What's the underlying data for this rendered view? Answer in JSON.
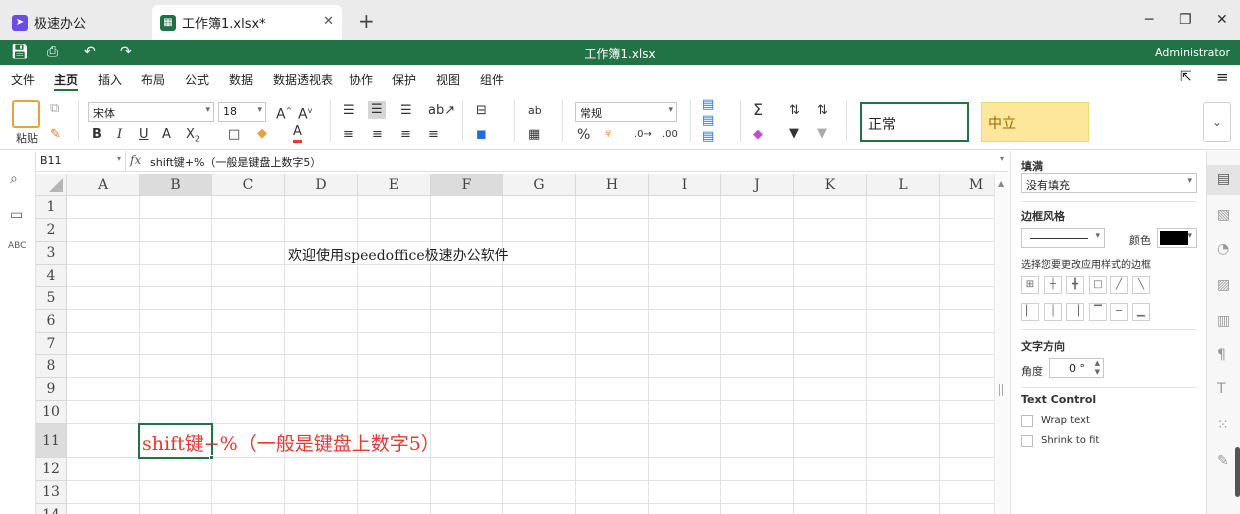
{
  "tabs": [
    {
      "label": "极速办公"
    },
    {
      "label": "工作簿1.xlsx*"
    }
  ],
  "window": {
    "title": "工作簿1.xlsx",
    "user": "Administrator"
  },
  "menu": [
    "文件",
    "主页",
    "插入",
    "布局",
    "公式",
    "数据",
    "数据透视表",
    "协作",
    "保护",
    "视图",
    "组件"
  ],
  "ribbon": {
    "paste_label": "粘贴",
    "font_name": "宋体",
    "font_size": "18",
    "number_format": "常规",
    "style_normal": "正常",
    "style_neutral": "中立",
    "colors": {
      "accent": "#217346",
      "neutral_bg": "#fde79b",
      "normal_border": "#217346",
      "font_color_bar": "#e53935"
    }
  },
  "formula_bar": {
    "cell_ref": "B11",
    "formula": "shift键+%（一般是键盘上数字5）"
  },
  "columns": [
    "A",
    "B",
    "C",
    "D",
    "E",
    "F",
    "G",
    "H",
    "I",
    "J",
    "K",
    "L",
    "M"
  ],
  "rows": [
    "1",
    "2",
    "3",
    "4",
    "5",
    "6",
    "7",
    "8",
    "9",
    "10",
    "11",
    "12",
    "13",
    "14"
  ],
  "cells": {
    "D3": "欢迎使用speedoffice极速办公软件",
    "B11": "shift键+%（一般是键盘上数字5）"
  },
  "panel": {
    "fill_title": "填满",
    "fill_value": "没有填充",
    "border_title": "边框风格",
    "color_label": "颜色",
    "border_hint": "选择您要更改应用样式的边框",
    "text_dir_title": "文字方向",
    "angle_label": "角度",
    "angle_value": "0 °",
    "text_control_title": "Text Control",
    "wrap_text": "Wrap text",
    "shrink_to_fit": "Shrink to fit"
  }
}
